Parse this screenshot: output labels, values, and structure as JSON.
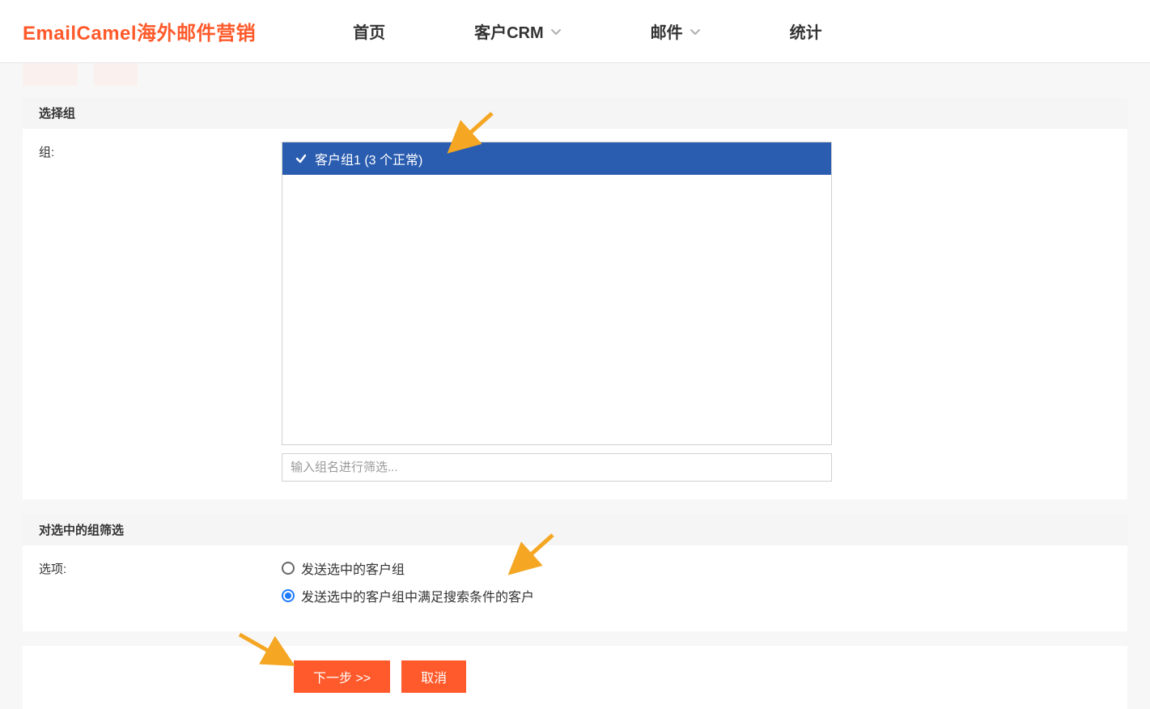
{
  "brand": "EmailCamel海外邮件营销",
  "nav": {
    "home": "首页",
    "crm": "客户CRM",
    "mail": "邮件",
    "stats": "统计"
  },
  "panel_select": {
    "title": "选择组",
    "field_label": "组:",
    "groups": [
      {
        "label": "客户组1 (3 个正常)",
        "selected": true
      }
    ],
    "filter_placeholder": "输入组名进行筛选..."
  },
  "panel_filter": {
    "title": "对选中的组筛选",
    "field_label": "选项:",
    "options": {
      "opt1": "发送选中的客户组",
      "opt2": "发送选中的客户组中满足搜索条件的客户",
      "selected": "opt2"
    }
  },
  "footer": {
    "next": "下一步 >>",
    "cancel": "取消"
  }
}
